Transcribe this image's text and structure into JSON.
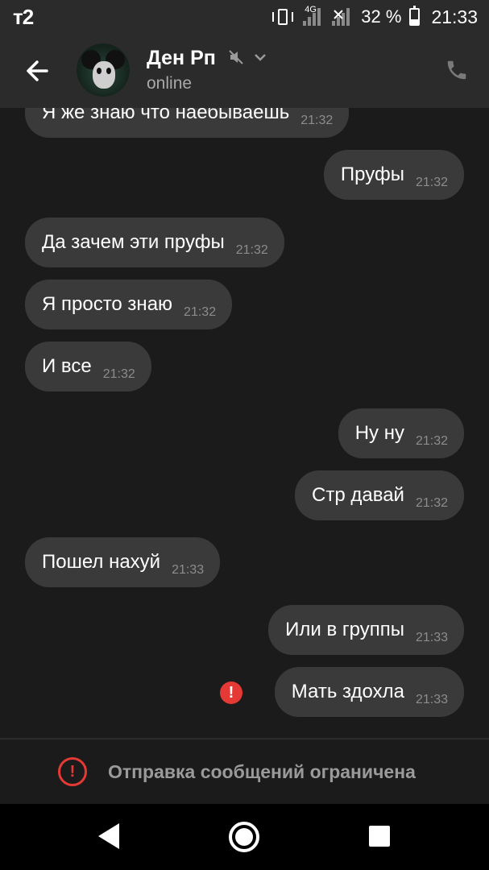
{
  "status_bar": {
    "carrier": "т2",
    "network": "4G",
    "battery_percent": "32 %",
    "battery_level": 0.32,
    "time": "21:33"
  },
  "header": {
    "contact_name": "Ден Рп",
    "status": "online",
    "icons": [
      "back-arrow-icon",
      "mute-icon",
      "chevron-down-icon",
      "phone-icon"
    ]
  },
  "messages": [
    {
      "text": "Я же знаю что наебываешь",
      "time": "21:32",
      "direction": "incoming"
    },
    {
      "text": "Пруфы",
      "time": "21:32",
      "direction": "outgoing"
    },
    {
      "text": "Да зачем эти пруфы",
      "time": "21:32",
      "direction": "incoming"
    },
    {
      "text": "Я просто знаю",
      "time": "21:32",
      "direction": "incoming"
    },
    {
      "text": "И все",
      "time": "21:32",
      "direction": "incoming"
    },
    {
      "text": "Ну ну",
      "time": "21:32",
      "direction": "outgoing"
    },
    {
      "text": "Стр давай",
      "time": "21:32",
      "direction": "outgoing"
    },
    {
      "text": "Пошел нахуй",
      "time": "21:33",
      "direction": "incoming"
    },
    {
      "text": "Или в группы",
      "time": "21:33",
      "direction": "outgoing"
    },
    {
      "text": "Мать здохла",
      "time": "21:33",
      "direction": "outgoing",
      "failed": true
    }
  ],
  "error_badge": "!",
  "restriction": {
    "icon_text": "!",
    "text": "Отправка сообщений ограничена"
  },
  "colors": {
    "background": "#1b1b1b",
    "header": "#2b2b2b",
    "bubble": "#3a3a3a",
    "error": "#e53935"
  }
}
